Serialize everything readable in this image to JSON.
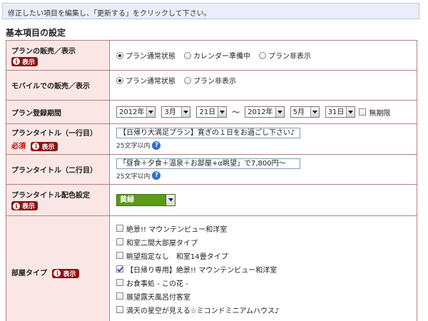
{
  "notice": "修正したい項目を編集し、「更新する」をクリックして下さい。",
  "section_title": "基本項目の設定",
  "badge_label": "表示",
  "required_label": "必須",
  "rows": {
    "sales": {
      "label": "プランの販売／表示",
      "options": [
        "プラン通常状態",
        "カレンダー準備中",
        "プラン非表示"
      ],
      "selected": 0
    },
    "mobile": {
      "label": "モバイルでの販売／表示",
      "options": [
        "プラン通常状態",
        "プラン非表示"
      ],
      "selected": 0
    },
    "period": {
      "label": "プラン登録期間",
      "start_year": "2012年",
      "start_month": "3月",
      "start_day": "21日",
      "separator": "～",
      "end_year": "2012年",
      "end_month": "5月",
      "end_day": "31日",
      "unlimited_label": "無期限",
      "unlimited_checked": false
    },
    "title1": {
      "label": "プランタイトル（一行目）",
      "value": "【日帰り大満足プラン】寛ぎの１日をお過ごし下さい♪",
      "hint": "25文字以内"
    },
    "title2": {
      "label": "プランタイトル（二行目）",
      "value": "「昼食＋夕食＋温泉＋お部屋+α眺望」で7,800円～",
      "hint": "25文字以内"
    },
    "color": {
      "label": "プランタイトル配色設定",
      "value": "黄緑",
      "swatch": "#5b9a1c"
    },
    "room": {
      "label": "部屋タイプ",
      "items": [
        {
          "label": "絶景!! マウンテンビュー和洋室",
          "checked": false
        },
        {
          "label": "和室二間大部屋タイプ",
          "checked": false
        },
        {
          "label": "眺望指定なし　和室14畳タイプ",
          "checked": false
        },
        {
          "label": "【日帰り専用】絶景!! マウンテンビュー和洋室",
          "checked": true
        },
        {
          "label": "お食事処 - この花 -",
          "checked": false
        },
        {
          "label": "展望露天風呂付客室",
          "checked": false
        },
        {
          "label": "満天の星空が見える☆ミコンドミニアムハウス♪",
          "checked": false
        }
      ]
    }
  },
  "colors": {
    "label_bg": "#fbe6e6",
    "border": "#b58080",
    "badge": "#8e1212",
    "notice_bg": "#e9eef8",
    "help": "#2f6fd1"
  },
  "icons": {
    "info": "info-icon",
    "help": "help-icon",
    "dropdown": "chevron-down-icon",
    "check": "check-icon"
  }
}
